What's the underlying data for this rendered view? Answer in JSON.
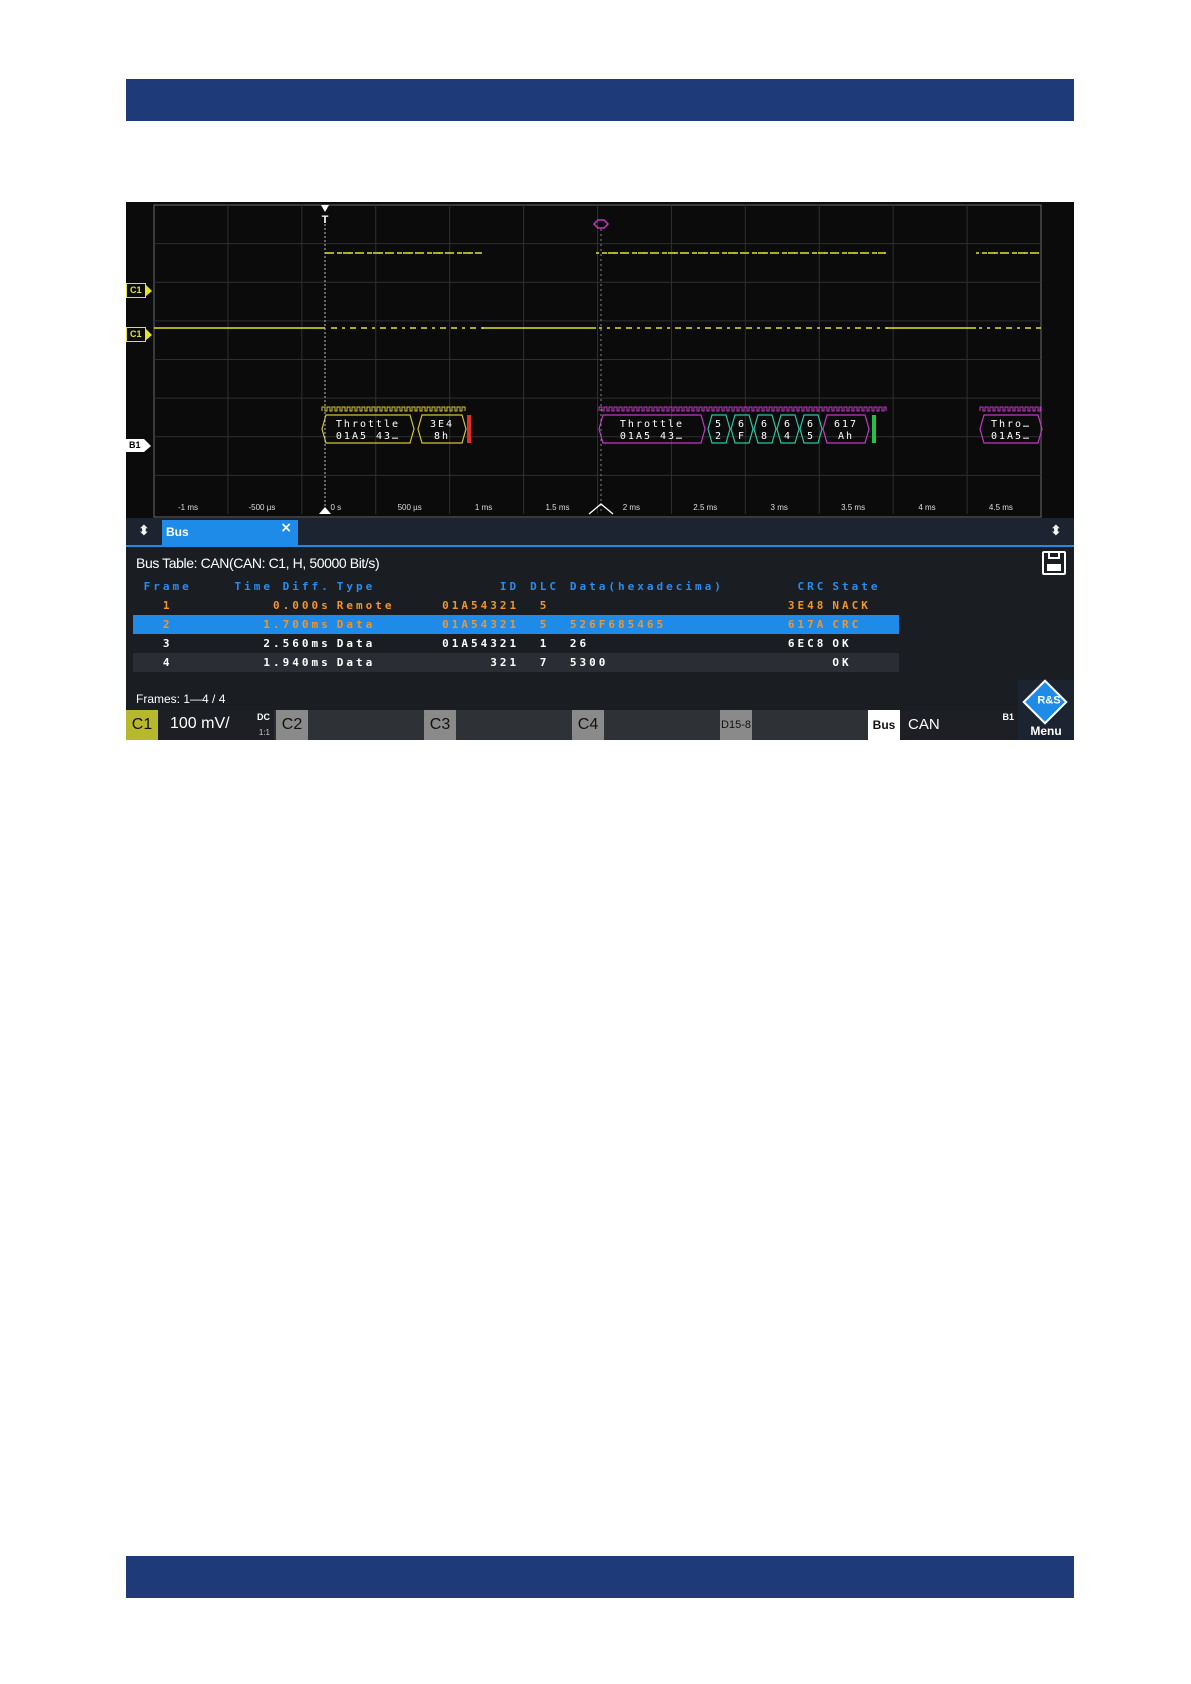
{
  "oscilloscope": {
    "channel_markers": {
      "c1_trigger": "C1",
      "c1": "C1",
      "b1": "B1"
    },
    "time_axis_ticks": [
      "-1 ms",
      "-500 µs",
      "0 s",
      "500 µs",
      "1 ms",
      "1.5 ms",
      "2 ms",
      "2.5 ms",
      "3 ms",
      "3.5 ms",
      "4 ms",
      "4.5 ms"
    ],
    "trigger_label": "T",
    "decoded_frames": [
      {
        "id_text": "Throttle",
        "id_hex": "01A5 43…",
        "fields": [
          {
            "top": "3E4",
            "bottom": "8h"
          }
        ]
      },
      {
        "id_text": "Throttle",
        "id_hex": "01A5 43…",
        "fields": [
          {
            "top": "5",
            "bottom": "2"
          },
          {
            "top": "6",
            "bottom": "F"
          },
          {
            "top": "6",
            "bottom": "8"
          },
          {
            "top": "6",
            "bottom": "4"
          },
          {
            "top": "6",
            "bottom": "5"
          },
          {
            "top": "617",
            "bottom": "Ah"
          }
        ]
      },
      {
        "id_text": "Thro…",
        "id_hex": "01A5…",
        "fields": []
      }
    ],
    "colors": {
      "channel": "#e2e22a",
      "frame_a": "#d4c23a",
      "frame_b": "#c238c2",
      "frame_c": "#2ec4a0",
      "error": "#e0302a",
      "ok": "#22c24a",
      "accent": "#1e8be8",
      "orange": "#f29429"
    }
  },
  "tab_bar": {
    "bus_tab_label": "Bus",
    "close_icon": "×",
    "up_down_icon": "⬍"
  },
  "bus_table": {
    "title": "Bus Table: CAN(CAN: C1, H, 50000 Bit/s)",
    "columns": [
      "Frame",
      "Time Diff.",
      "Type",
      "ID",
      "DLC",
      "Data(hexadecima)",
      "CRC",
      "State"
    ],
    "rows": [
      {
        "frame": "1",
        "time_diff": "0.000s",
        "type": "Remote",
        "id": "01A54321",
        "dlc": "5",
        "data": "",
        "crc": "3E48",
        "state": "NACK"
      },
      {
        "frame": "2",
        "time_diff": "1.700ms",
        "type": "Data",
        "id": "01A54321",
        "dlc": "5",
        "data": "526F685465",
        "crc": "617A",
        "state": "CRC"
      },
      {
        "frame": "3",
        "time_diff": "2.560ms",
        "type": "Data",
        "id": "01A54321",
        "dlc": "1",
        "data": "26",
        "crc": "6EC8",
        "state": "OK"
      },
      {
        "frame": "4",
        "time_diff": "1.940ms",
        "type": "Data",
        "id": "321",
        "dlc": "7",
        "data": "5300",
        "crc": "",
        "state": "OK"
      }
    ],
    "frames_summary": "Frames:  1—4 / 4"
  },
  "bottom_bar": {
    "c1": {
      "label": "C1",
      "scale": "100 mV/",
      "coupling": "DC",
      "ratio": "1:1"
    },
    "c2": {
      "label": "C2"
    },
    "c3": {
      "label": "C3"
    },
    "c4": {
      "label": "C4"
    },
    "digital": {
      "label": "D15-8"
    },
    "bus": {
      "label": "Bus",
      "protocol": "CAN",
      "index": "B1"
    },
    "menu": {
      "label": "Menu",
      "logo": "R&S"
    }
  }
}
